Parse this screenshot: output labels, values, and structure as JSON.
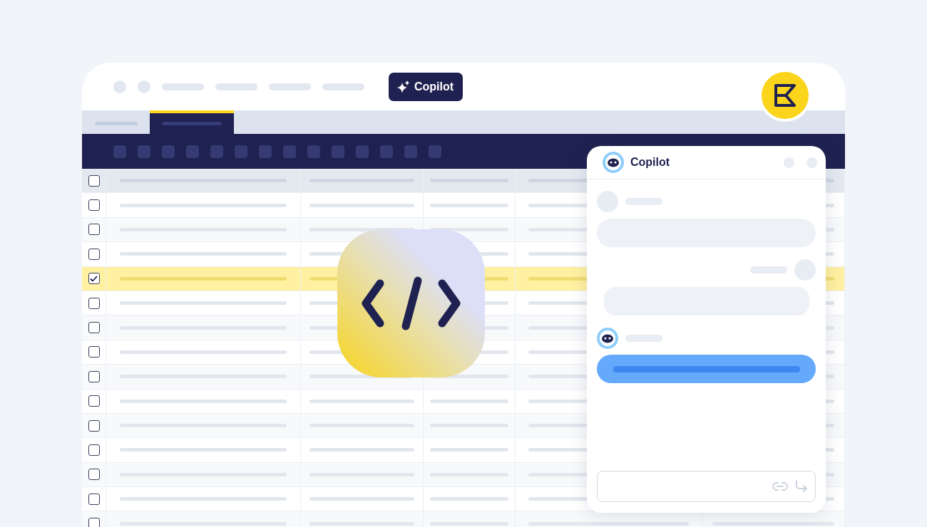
{
  "top_bar": {
    "copilot_button": "Copilot"
  },
  "tabs": [
    {
      "selected": false
    },
    {
      "selected": true
    }
  ],
  "table": {
    "header_checked": false,
    "rows": [
      {
        "checked": false,
        "selected": false
      },
      {
        "checked": false,
        "selected": false
      },
      {
        "checked": false,
        "selected": false
      },
      {
        "checked": true,
        "selected": true
      },
      {
        "checked": false,
        "selected": false
      },
      {
        "checked": false,
        "selected": false
      },
      {
        "checked": false,
        "selected": false
      },
      {
        "checked": false,
        "selected": false
      },
      {
        "checked": false,
        "selected": false
      },
      {
        "checked": false,
        "selected": false
      },
      {
        "checked": false,
        "selected": false
      },
      {
        "checked": false,
        "selected": false
      },
      {
        "checked": false,
        "selected": false
      },
      {
        "checked": false,
        "selected": false
      }
    ]
  },
  "chat": {
    "title": "Copilot"
  }
}
